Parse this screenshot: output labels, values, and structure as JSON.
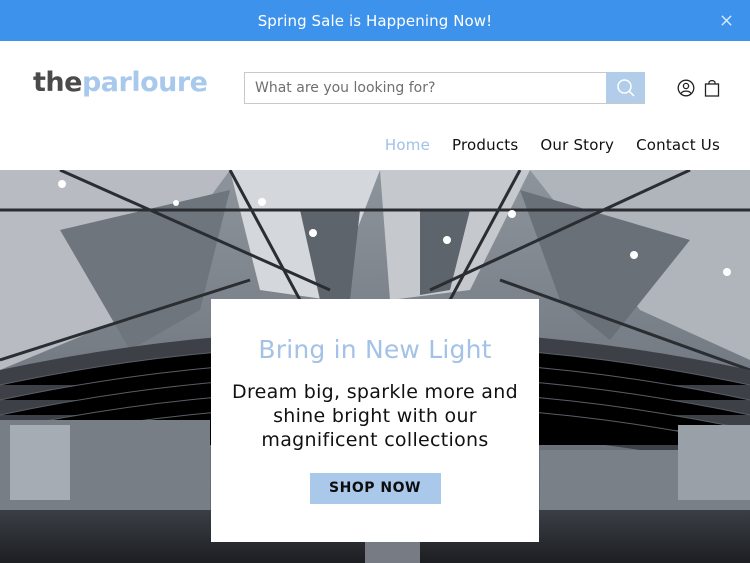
{
  "announcement": {
    "text": "Spring Sale is Happening Now!"
  },
  "header": {
    "logo_part1": "the",
    "logo_part2": "parloure",
    "search_placeholder": "What are you looking for?"
  },
  "nav": {
    "items": [
      {
        "label": "Home",
        "active": true
      },
      {
        "label": "Products",
        "active": false
      },
      {
        "label": "Our Story",
        "active": false
      },
      {
        "label": "Contact Us",
        "active": false
      }
    ]
  },
  "hero": {
    "title": "Bring in New Light",
    "subtitle": "Dream big, sparkle more and shine bright with our magnificent collections",
    "cta": "SHOP NOW"
  },
  "colors": {
    "announcement_bg": "#3d93ec",
    "accent": "#a9c8ea",
    "logo_dark": "#4a4a4a"
  },
  "icons": [
    "close-icon",
    "search-icon",
    "account-icon",
    "cart-icon"
  ]
}
